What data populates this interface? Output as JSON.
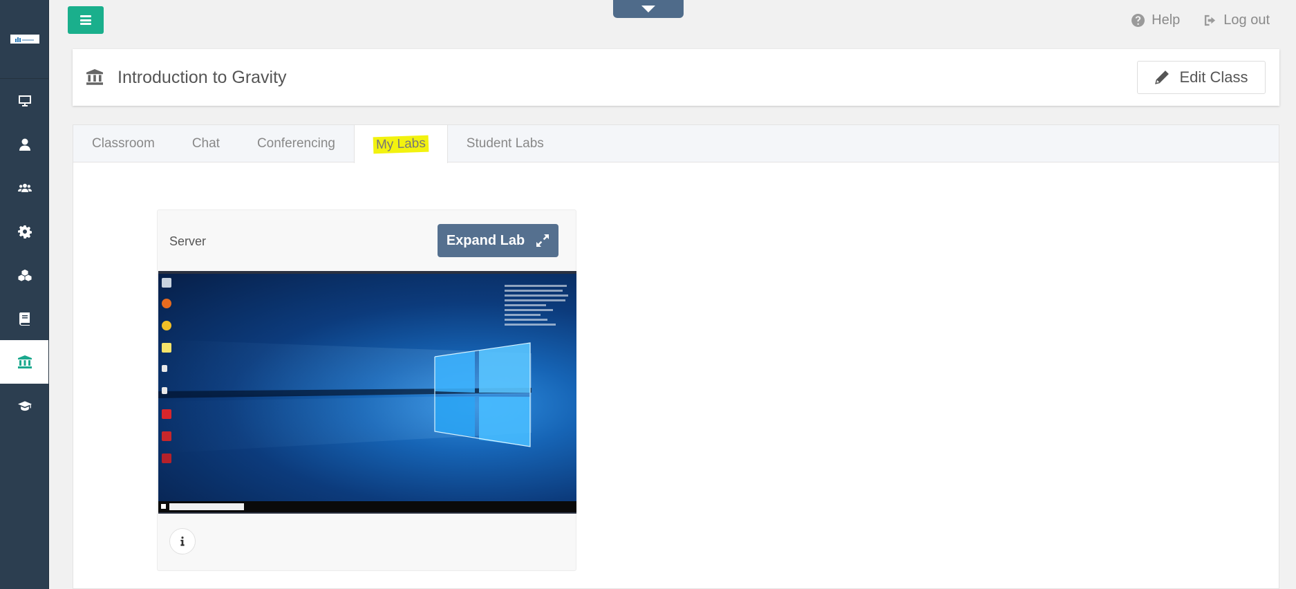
{
  "sidebar": {
    "logo_text": "",
    "items": [
      {
        "icon": "desktop-icon"
      },
      {
        "icon": "user-icon"
      },
      {
        "icon": "users-icon"
      },
      {
        "icon": "gear-icon"
      },
      {
        "icon": "cubes-icon"
      },
      {
        "icon": "book-icon"
      },
      {
        "icon": "institution-icon",
        "active": true
      },
      {
        "icon": "graduation-cap-icon"
      }
    ]
  },
  "topbar": {
    "help_label": "Help",
    "logout_label": "Log out"
  },
  "class_header": {
    "title": "Introduction to Gravity",
    "edit_label": "Edit Class"
  },
  "tabs": [
    {
      "label": "Classroom"
    },
    {
      "label": "Chat"
    },
    {
      "label": "Conferencing"
    },
    {
      "label": "My Labs",
      "active": true,
      "highlight": "#f2f20f"
    },
    {
      "label": "Student Labs"
    }
  ],
  "lab": {
    "name": "Server",
    "expand_label": "Expand Lab"
  },
  "colors": {
    "sidebar_bg": "#2c3e50",
    "accent": "#1aaf8c",
    "expand_btn": "#55708f"
  }
}
